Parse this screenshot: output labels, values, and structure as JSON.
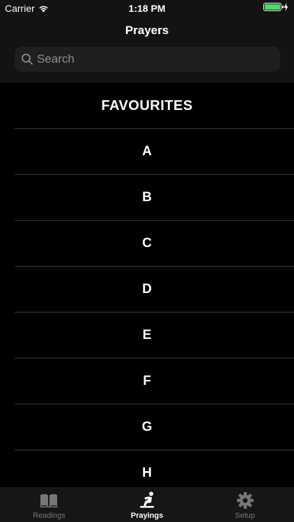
{
  "status": {
    "carrier": "Carrier",
    "time": "1:18 PM",
    "battery_color": "#4cd964"
  },
  "nav": {
    "title": "Prayers"
  },
  "search": {
    "placeholder": "Search",
    "value": ""
  },
  "list": {
    "header": "FAVOURITES",
    "letters": [
      "A",
      "B",
      "C",
      "D",
      "E",
      "F",
      "G",
      "H"
    ]
  },
  "tabs": [
    {
      "label": "Readings",
      "icon": "book-icon",
      "active": false
    },
    {
      "label": "Prayings",
      "icon": "praying-icon",
      "active": true
    },
    {
      "label": "Setup",
      "icon": "gear-icon",
      "active": false
    }
  ]
}
